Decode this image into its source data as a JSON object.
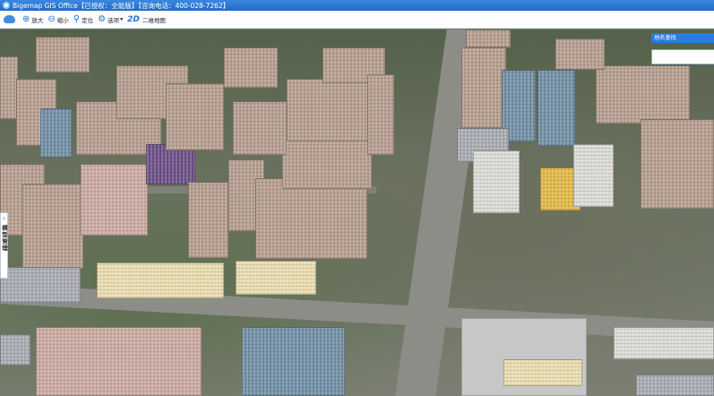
{
  "window": {
    "title": "Bigemap GIS Office【已授权：全能版】【咨询电话：400-028-7262】"
  },
  "toolbar": {
    "items": [
      {
        "label": "放大",
        "icon": "zoom-in-icon",
        "glyph": "⊕"
      },
      {
        "label": "缩小",
        "icon": "zoom-out-icon",
        "glyph": "⊖"
      },
      {
        "label": "定位",
        "icon": "location-pin-icon",
        "glyph": "⚲"
      },
      {
        "label": "选项",
        "icon": "gear-icon",
        "glyph": "⚙"
      },
      {
        "label": "二维地图",
        "icon": "2d-map-icon",
        "glyph": "2D"
      }
    ]
  },
  "side_panel": {
    "label": "模型管理",
    "arrow": "›"
  },
  "search_panel": {
    "title": "地名查找",
    "placeholder": ""
  },
  "colors": {
    "accent": "#2a7be0",
    "titlebar": "#1f6cc9"
  }
}
